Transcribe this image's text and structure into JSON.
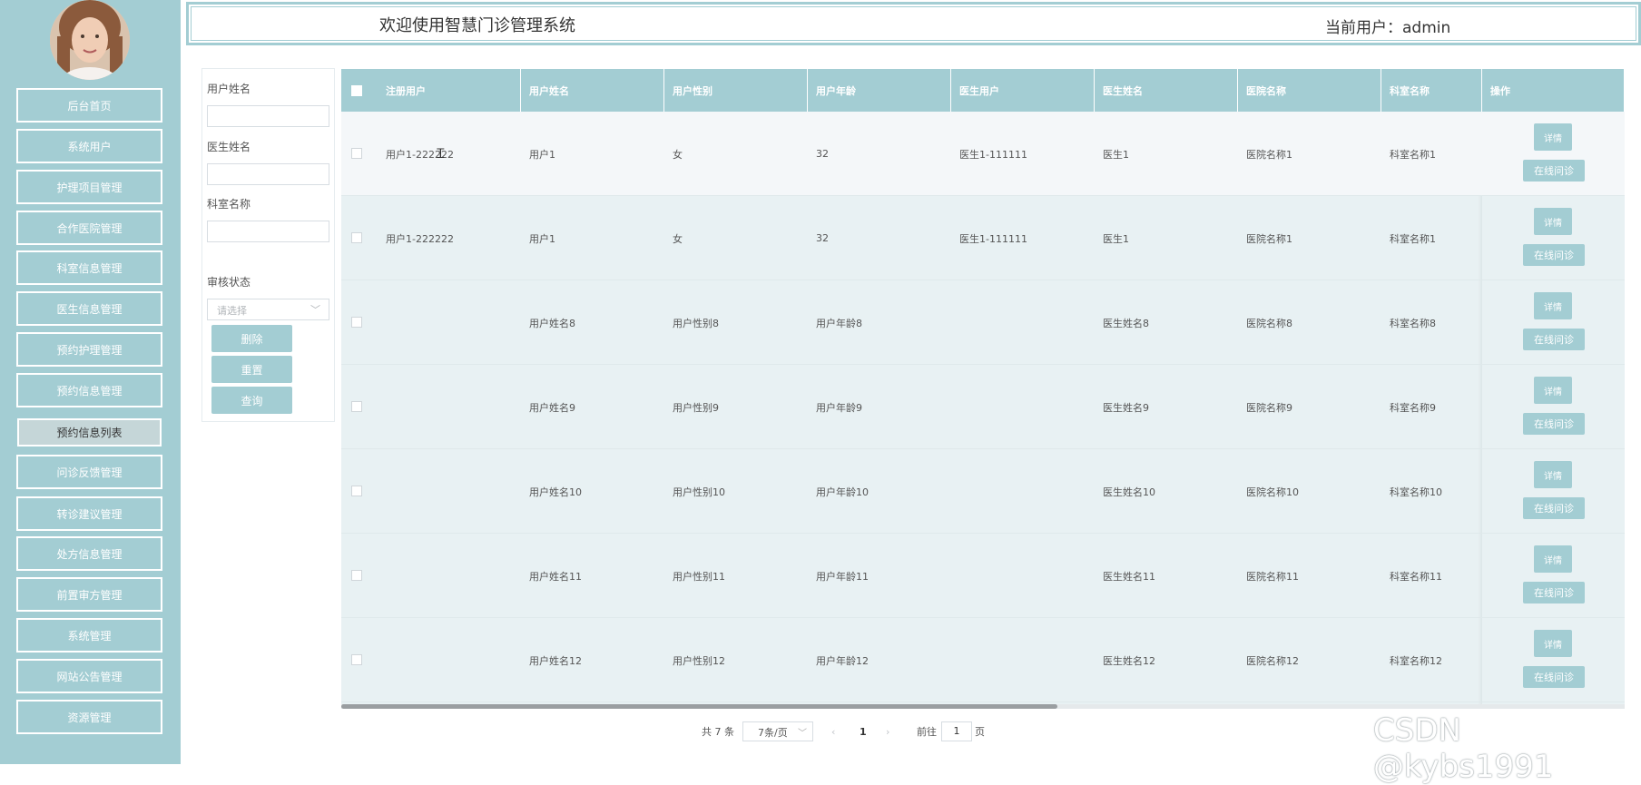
{
  "header": {
    "title": "欢迎使用智慧门诊管理系统",
    "user_label": "当前用户：admin"
  },
  "sidebar": {
    "items": [
      {
        "label": "后台首页"
      },
      {
        "label": "系统用户"
      },
      {
        "label": "护理项目管理"
      },
      {
        "label": "合作医院管理"
      },
      {
        "label": "科室信息管理"
      },
      {
        "label": "医生信息管理"
      },
      {
        "label": "预约护理管理"
      },
      {
        "label": "预约信息管理"
      },
      {
        "label": "预约信息列表"
      },
      {
        "label": "问诊反馈管理"
      },
      {
        "label": "转诊建议管理"
      },
      {
        "label": "处方信息管理"
      },
      {
        "label": "前置审方管理"
      },
      {
        "label": "系统管理"
      },
      {
        "label": "网站公告管理"
      },
      {
        "label": "资源管理"
      }
    ],
    "active_index": 8
  },
  "search": {
    "user_name_label": "用户姓名",
    "doctor_name_label": "医生姓名",
    "dept_name_label": "科室名称",
    "audit_status_label": "审核状态",
    "audit_status_placeholder": "请选择",
    "delete_label": "删除",
    "reset_label": "重置",
    "query_label": "查询"
  },
  "table": {
    "headers": [
      "注册用户",
      "用户姓名",
      "用户性别",
      "用户年龄",
      "医生用户",
      "医生姓名",
      "医院名称",
      "科室名称",
      "操作"
    ],
    "detail_label": "详情",
    "online_label": "在线问诊",
    "rows": [
      [
        "用户1-222222",
        "用户1",
        "女",
        "32",
        "医生1-111111",
        "医生1",
        "医院名称1",
        "科室名称1"
      ],
      [
        "用户1-222222",
        "用户1",
        "女",
        "32",
        "医生1-111111",
        "医生1",
        "医院名称1",
        "科室名称1"
      ],
      [
        "",
        "用户姓名8",
        "用户性别8",
        "用户年龄8",
        "",
        "医生姓名8",
        "医院名称8",
        "科室名称8"
      ],
      [
        "",
        "用户姓名9",
        "用户性别9",
        "用户年龄9",
        "",
        "医生姓名9",
        "医院名称9",
        "科室名称9"
      ],
      [
        "",
        "用户姓名10",
        "用户性别10",
        "用户年龄10",
        "",
        "医生姓名10",
        "医院名称10",
        "科室名称10"
      ],
      [
        "",
        "用户姓名11",
        "用户性别11",
        "用户年龄11",
        "",
        "医生姓名11",
        "医院名称11",
        "科室名称11"
      ],
      [
        "",
        "用户姓名12",
        "用户性别12",
        "用户年龄12",
        "",
        "医生姓名12",
        "医院名称12",
        "科室名称12"
      ]
    ]
  },
  "pagination": {
    "total": "共 7 条",
    "page_size": "7条/页",
    "current_page": "1",
    "goto_label": "前往",
    "goto_value": "1",
    "page_unit": "页",
    "prev_icon": "‹",
    "next_icon": "›"
  },
  "watermark": "CSDN @kybs1991",
  "colors": {
    "accent": "#a3cdd3",
    "table_bg": "#e8f1f3"
  }
}
